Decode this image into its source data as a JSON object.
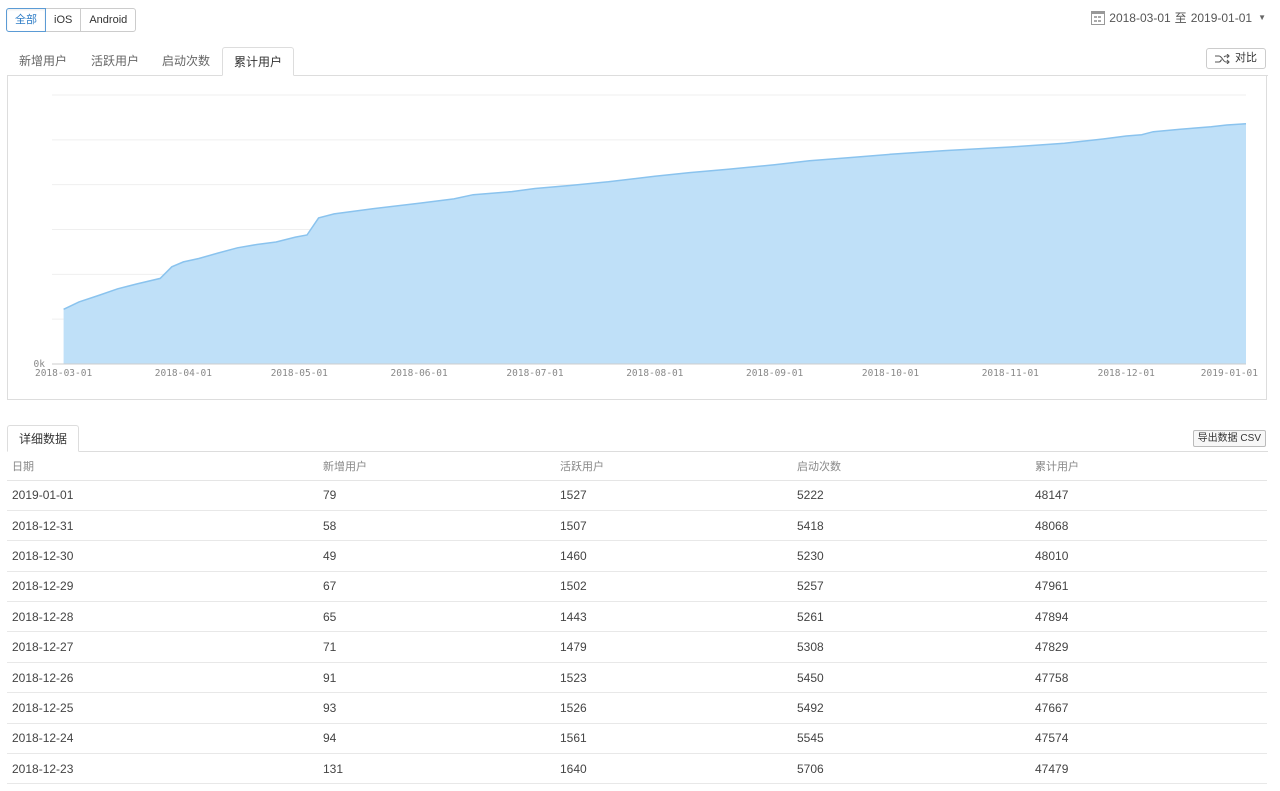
{
  "platform_filter": {
    "options": [
      "全部",
      "iOS",
      "Android"
    ],
    "selected": "全部"
  },
  "date_range": {
    "start": "2018-03-01",
    "separator": "至",
    "end": "2019-01-01"
  },
  "metric_tabs": [
    {
      "label": "新增用户",
      "active": false
    },
    {
      "label": "活跃用户",
      "active": false
    },
    {
      "label": "启动次数",
      "active": false
    },
    {
      "label": "累计用户",
      "active": true
    }
  ],
  "compare_label": "对比",
  "chart_data": {
    "type": "area",
    "series": [
      {
        "color": "#8ac3ee",
        "points": [
          [
            "2018-03-01",
            8950
          ],
          [
            "2018-03-05",
            10150
          ],
          [
            "2018-03-10",
            11200
          ],
          [
            "2018-03-15",
            12300
          ],
          [
            "2018-03-20",
            13100
          ],
          [
            "2018-03-26",
            14000
          ],
          [
            "2018-03-29",
            15900
          ],
          [
            "2018-04-01",
            16700
          ],
          [
            "2018-04-05",
            17250
          ],
          [
            "2018-04-10",
            18150
          ],
          [
            "2018-04-15",
            19000
          ],
          [
            "2018-04-20",
            19550
          ],
          [
            "2018-04-25",
            19950
          ],
          [
            "2018-04-30",
            20750
          ],
          [
            "2018-05-03",
            21100
          ],
          [
            "2018-05-06",
            23900
          ],
          [
            "2018-05-10",
            24550
          ],
          [
            "2018-05-20",
            25400
          ],
          [
            "2018-06-01",
            26300
          ],
          [
            "2018-06-10",
            27000
          ],
          [
            "2018-06-15",
            27700
          ],
          [
            "2018-06-25",
            28200
          ],
          [
            "2018-07-01",
            28700
          ],
          [
            "2018-07-10",
            29200
          ],
          [
            "2018-07-20",
            29800
          ],
          [
            "2018-08-01",
            30700
          ],
          [
            "2018-08-10",
            31300
          ],
          [
            "2018-08-20",
            31850
          ],
          [
            "2018-09-01",
            32600
          ],
          [
            "2018-09-10",
            33250
          ],
          [
            "2018-09-20",
            33750
          ],
          [
            "2018-10-01",
            34300
          ],
          [
            "2018-10-15",
            34900
          ],
          [
            "2018-11-01",
            35500
          ],
          [
            "2018-11-15",
            36100
          ],
          [
            "2018-11-25",
            36800
          ],
          [
            "2018-12-01",
            37300
          ],
          [
            "2018-12-05",
            37500
          ],
          [
            "2018-12-08",
            38000
          ],
          [
            "2018-12-15",
            38400
          ],
          [
            "2018-12-23",
            38800
          ],
          [
            "2018-12-27",
            39100
          ],
          [
            "2019-01-01",
            39300
          ]
        ]
      }
    ],
    "x_ticks": [
      "2018-03-01",
      "2018-04-01",
      "2018-05-01",
      "2018-06-01",
      "2018-07-01",
      "2018-08-01",
      "2018-09-01",
      "2018-10-01",
      "2018-11-01",
      "2018-12-01",
      "2019-01-01"
    ],
    "y_tick_label": "0k",
    "ylim": [
      0,
      44000
    ],
    "xlim": [
      "2018-02-26",
      "2019-01-01"
    ],
    "grid": true,
    "legend": "none"
  },
  "details": {
    "tab_label": "详细数据",
    "export_label": "导出数据 CSV",
    "columns": [
      "日期",
      "新增用户",
      "活跃用户",
      "启动次数",
      "累计用户"
    ],
    "rows": [
      [
        "2019-01-01",
        "79",
        "1527",
        "5222",
        "48147"
      ],
      [
        "2018-12-31",
        "58",
        "1507",
        "5418",
        "48068"
      ],
      [
        "2018-12-30",
        "49",
        "1460",
        "5230",
        "48010"
      ],
      [
        "2018-12-29",
        "67",
        "1502",
        "5257",
        "47961"
      ],
      [
        "2018-12-28",
        "65",
        "1443",
        "5261",
        "47894"
      ],
      [
        "2018-12-27",
        "71",
        "1479",
        "5308",
        "47829"
      ],
      [
        "2018-12-26",
        "91",
        "1523",
        "5450",
        "47758"
      ],
      [
        "2018-12-25",
        "93",
        "1526",
        "5492",
        "47667"
      ],
      [
        "2018-12-24",
        "94",
        "1561",
        "5545",
        "47574"
      ],
      [
        "2018-12-23",
        "131",
        "1640",
        "5706",
        "47479"
      ]
    ]
  }
}
